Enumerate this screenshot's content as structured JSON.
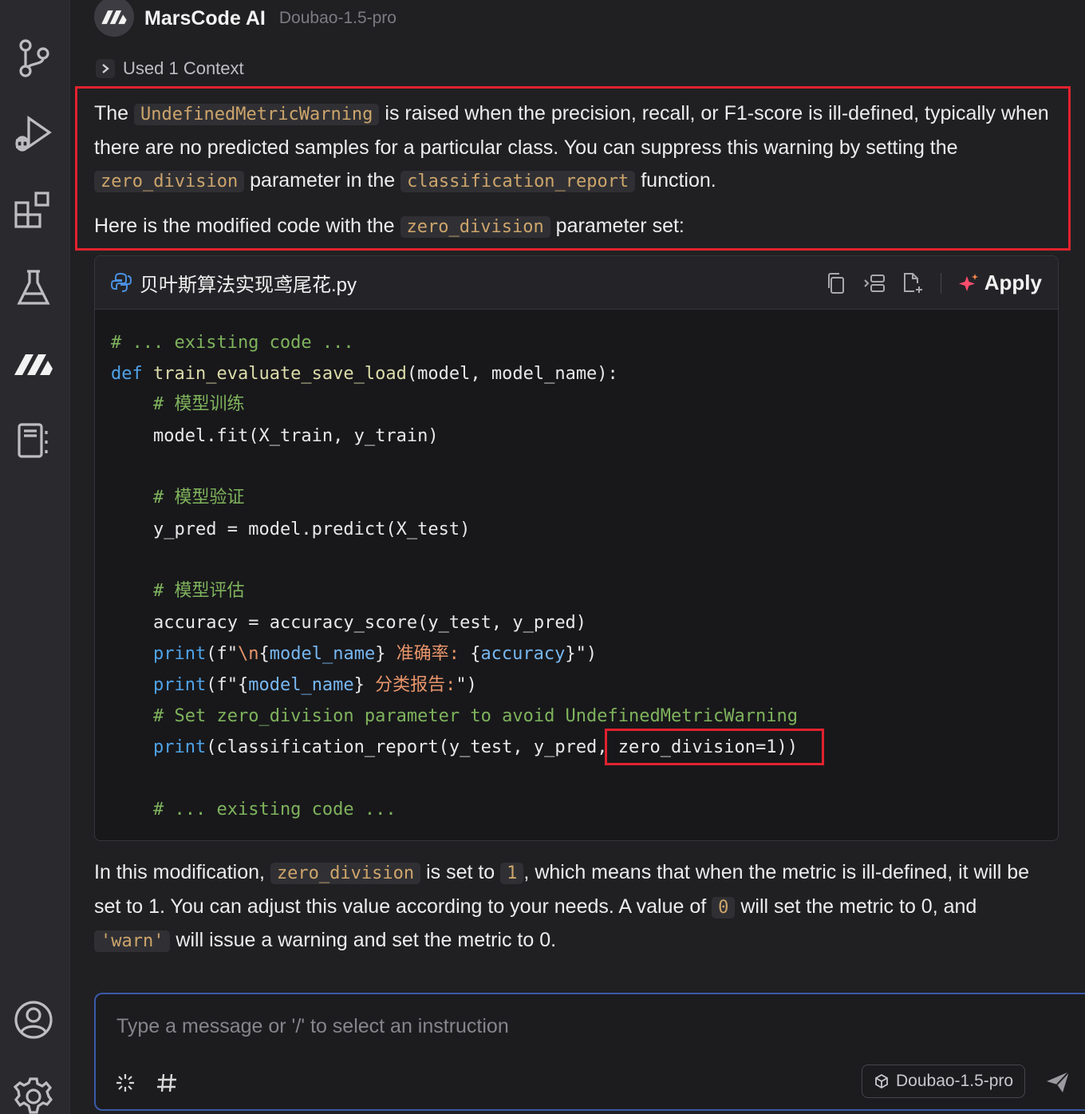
{
  "activity_bar": {
    "items": [
      "source-control-icon",
      "run-debug-icon",
      "extensions-icon",
      "testing-flask-icon",
      "marscode-icon",
      "notebook-icon"
    ],
    "bottom": [
      "account-icon",
      "settings-icon"
    ]
  },
  "header": {
    "agent_name": "MarsCode AI",
    "model_name": "Doubao-1.5-pro"
  },
  "context": {
    "label": "Used 1 Context"
  },
  "message": {
    "p1": {
      "t1": "The ",
      "c1": "UndefinedMetricWarning",
      "t2": " is raised when the precision, recall, or F1-score is ill-defined, typically when there are no predicted samples for a particular class. You can suppress this warning by setting the ",
      "c2": "zero_division",
      "t3": " parameter in the ",
      "c3": "classification_report",
      "t4": " function."
    },
    "p2": {
      "t1": "Here is the modified code with the ",
      "c1": "zero_division",
      "t2": " parameter set:"
    },
    "p3": {
      "t1": "In this modification, ",
      "c1": "zero_division",
      "t2": " is set to ",
      "c2": "1",
      "t3": ", which means that when the metric is ill-defined, it will be set to 1. You can adjust this value according to your needs. A value of ",
      "c3": "0",
      "t4": " will set the metric to 0, and ",
      "c4": "'warn'",
      "t5": " will issue a warning and set the metric to 0."
    }
  },
  "code_block": {
    "file_name": "贝叶斯算法实现鸢尾花.py",
    "apply_label": "Apply",
    "lines": {
      "l1": "# ... existing code ...",
      "l2_kw": "def",
      "l2_fn": "train_evaluate_save_load",
      "l2_rest": "(model, model_name):",
      "l3": "# 模型训练",
      "l4": "model.fit(X_train, y_train)",
      "l5": "# 模型验证",
      "l6": "y_pred = model.predict(X_test)",
      "l7": "# 模型评估",
      "l8": "accuracy = accuracy_score(y_test, y_pred)",
      "l9_kw": "print",
      "l9_a": "(f\"",
      "l9_b": "\\n",
      "l9_c": "{",
      "l9_d": "model_name",
      "l9_e": "}",
      "l9_f": " 准确率: ",
      "l9_g": "{",
      "l9_h": "accuracy",
      "l9_i": "}\")",
      "l10_kw": "print",
      "l10_a": "(f\"{",
      "l10_b": "model_name",
      "l10_c": "}",
      "l10_d": " 分类报告:",
      "l10_e": "\")",
      "l11": "# Set zero_division parameter to avoid UndefinedMetricWarning",
      "l12_kw": "print",
      "l12_rest": "(classification_report(y_test, y_pred, zero_division=1))",
      "l13": "# ... existing code ..."
    }
  },
  "input": {
    "placeholder": "Type a message or '/' to select an instruction",
    "value": "",
    "model_pill": "Doubao-1.5-pro"
  }
}
